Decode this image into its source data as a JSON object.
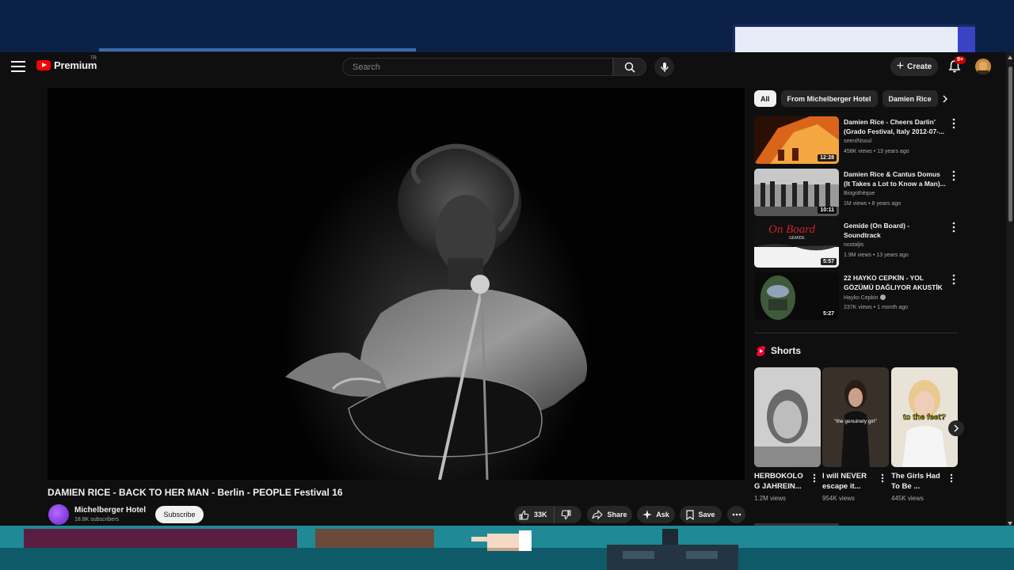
{
  "header": {
    "logo_text": "Premium",
    "logo_superscript": "TR",
    "search_placeholder": "Search",
    "create_label": "Create",
    "notification_count": "9+"
  },
  "video": {
    "title": "DAMIEN RICE - BACK TO HER MAN - Berlin - PEOPLE Festival 16",
    "channel": "Michelberger Hotel",
    "subscribers": "18.8K subscribers",
    "subscribe_label": "Subscribe",
    "likes": "33K",
    "share_label": "Share",
    "ask_label": "Ask",
    "save_label": "Save"
  },
  "chips": [
    "All",
    "From Michelberger Hotel",
    "Damien Rice"
  ],
  "recommendations": [
    {
      "title": "Damien Rice - Cheers Darlin' (Grado Festival, Italy 2012-07-...",
      "channel": "seenINsoul",
      "meta": "458K views • 13 years ago",
      "duration": "12:28"
    },
    {
      "title": "Damien Rice & Cantus Domus (It Takes a Lot to Know a Man)...",
      "channel": "Biogothèque",
      "meta": "1M views • 8 years ago",
      "duration": "10:11"
    },
    {
      "title": "Gemide (On Board) - Soundtrack",
      "channel": "nostaljis",
      "meta": "1.9M views • 13 years ago",
      "duration": "5:57"
    },
    {
      "title": "22 HAYKO CEPKİN - YOL GÖZÜMÜ DAĞLIYOR AKUSTİK ...",
      "channel": "Hayko Cepkin",
      "meta": "237K views • 1 month ago",
      "duration": "5:27"
    }
  ],
  "thumb_texts": {
    "on_board": "On Board",
    "gemide": "GEMIDE",
    "short2_caption": "\"the genuinely girl\"",
    "short3_caption": "to the feet?"
  },
  "shorts": {
    "heading": "Shorts",
    "items": [
      {
        "title": "HERBOKOLO G JAHREIN...",
        "views": "1.2M views"
      },
      {
        "title": "I will NEVER escape it... ",
        "views": "954K views"
      },
      {
        "title": "The Girls Had To Be ...",
        "views": "445K views"
      }
    ]
  },
  "colors": {
    "accent": "#ff0000",
    "background": "#0f0f0f",
    "chip_active": "#f1f1f1"
  }
}
